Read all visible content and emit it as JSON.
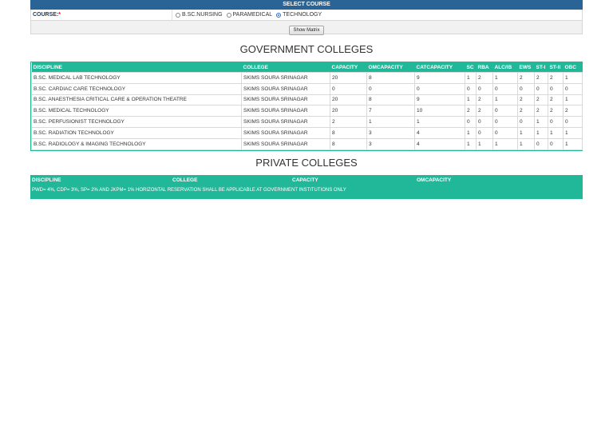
{
  "select_course": {
    "header": "SELECT COURSE",
    "course_label": "COURSE:",
    "required_mark": "*",
    "options": [
      {
        "label": "B.SC.NURSING",
        "selected": false
      },
      {
        "label": "PARAMEDICAL",
        "selected": false
      },
      {
        "label": "TECHNOLOGY",
        "selected": true
      }
    ],
    "show_button": "Show Matrix"
  },
  "government": {
    "title": "GOVERNMENT COLLEGES",
    "columns": [
      "DISCIPLINE",
      "COLLEGE",
      "CAPACITY",
      "OMCAPACITY",
      "CATCAPACITY",
      "SC",
      "RBA",
      "ALC/IB",
      "EWS",
      "ST-I",
      "ST-II",
      "OBC"
    ],
    "rows": [
      [
        "B.SC. MEDICAL LAB TECHNOLOGY",
        "SKIMS SOURA SRINAGAR",
        "20",
        "8",
        "9",
        "1",
        "2",
        "1",
        "2",
        "2",
        "2",
        "1"
      ],
      [
        "B.SC. CARDIAC CARE TECHNOLOGY",
        "SKIMS SOURA SRINAGAR",
        "0",
        "0",
        "0",
        "0",
        "0",
        "0",
        "0",
        "0",
        "0",
        "0"
      ],
      [
        "B.SC. ANAESTHESIA CRITICAL CARE & OPERATION THEATRE",
        "SKIMS SOURA SRINAGAR",
        "20",
        "8",
        "9",
        "1",
        "2",
        "1",
        "2",
        "2",
        "2",
        "1"
      ],
      [
        "B.SC. MEDICAL TECHNOLOGY",
        "SKIMS SOURA SRINAGAR",
        "20",
        "7",
        "10",
        "2",
        "2",
        "0",
        "2",
        "2",
        "2",
        "2"
      ],
      [
        "B.SC. PERFUSIONIST TECHNOLOGY",
        "SKIMS SOURA SRINAGAR",
        "2",
        "1",
        "1",
        "0",
        "0",
        "0",
        "0",
        "1",
        "0",
        "0"
      ],
      [
        "B.SC. RADIATION TECHNOLOGY",
        "SKIMS SOURA SRINAGAR",
        "8",
        "3",
        "4",
        "1",
        "0",
        "0",
        "1",
        "1",
        "1",
        "1"
      ],
      [
        "B.SC. RADIOLOGY & IMAGING TECHNOLOGY",
        "SKIMS SOURA SRINAGAR",
        "8",
        "3",
        "4",
        "1",
        "1",
        "1",
        "1",
        "0",
        "0",
        "1"
      ]
    ]
  },
  "private": {
    "title": "PRIVATE COLLEGES",
    "columns": [
      "DISCIPLINE",
      "COLLEGE",
      "CAPACITY",
      "OMCAPACITY"
    ],
    "note": "PWD= 4%, CDP= 3%, SP= 2% AND JKPM= 1% HORIZONTAL RESERVATION SHALL BE APPLICABLE AT GOVERNMENT INSTITUTIONS ONLY"
  },
  "colors": {
    "header_blue": "#2a6496",
    "table_teal": "#20b899"
  }
}
